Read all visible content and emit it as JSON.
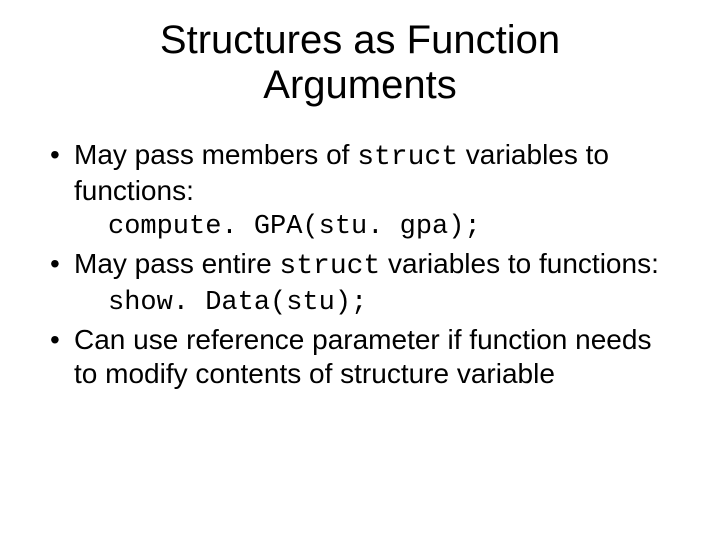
{
  "title_line1": "Structures as Function",
  "title_line2": "Arguments",
  "bullets": {
    "b1_pre": "May pass members of ",
    "b1_code": "struct",
    "b1_post": " variables to functions:",
    "code1": "compute. GPA(stu. gpa);",
    "b2_pre": "May pass entire ",
    "b2_code": "struct",
    "b2_post": " variables to functions:",
    "code2": "show. Data(stu);",
    "b3": "Can use reference parameter if function needs to modify contents of structure variable"
  }
}
